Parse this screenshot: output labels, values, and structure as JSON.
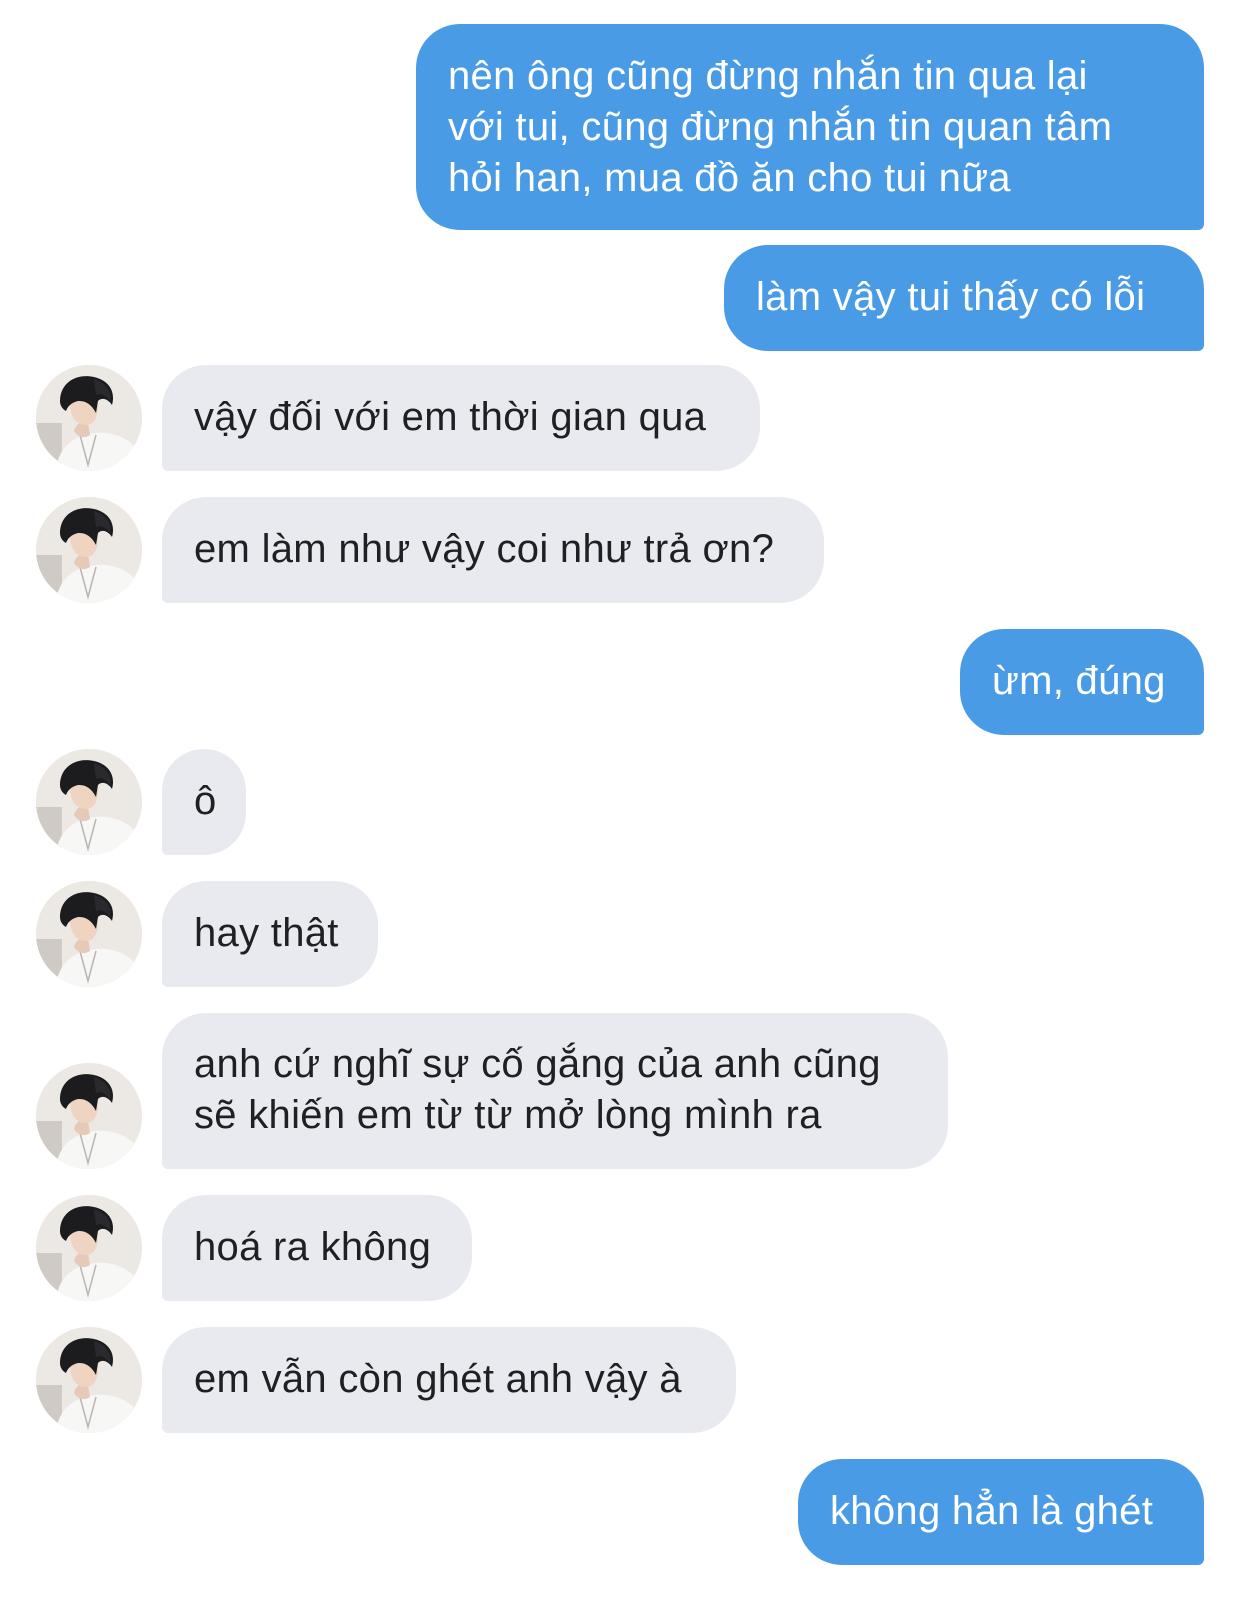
{
  "conversation": {
    "messages": [
      {
        "sender": "me",
        "text": "nên ông cũng đừng nhắn tin qua lại\nvới tui, cũng đừng nhắn tin quan tâm\nhỏi han, mua đồ ăn cho tui nữa"
      },
      {
        "sender": "me",
        "text": "làm vậy tui thấy có lỗi"
      },
      {
        "sender": "them",
        "text": "vậy đối với em thời gian qua"
      },
      {
        "sender": "them",
        "text": "em làm như vậy coi như trả ơn?"
      },
      {
        "sender": "me",
        "text": "ừm, đúng"
      },
      {
        "sender": "them",
        "text": "ô"
      },
      {
        "sender": "them",
        "text": "hay thật"
      },
      {
        "sender": "them",
        "text": "anh cứ nghĩ sự cố gắng của anh cũng\nsẽ khiến em từ từ mở lòng mình ra"
      },
      {
        "sender": "them",
        "text": "hoá ra không"
      },
      {
        "sender": "them",
        "text": "em vẫn còn ghét anh vậy à"
      },
      {
        "sender": "me",
        "text": "không hẳn là ghét"
      }
    ]
  },
  "theme": {
    "sent_bubble_color": "#4a9be6",
    "received_bubble_color": "#e8eaef",
    "sent_text_color": "#ffffff",
    "received_text_color": "#1f2023",
    "avatar_icon": "profile-photo-icon"
  }
}
